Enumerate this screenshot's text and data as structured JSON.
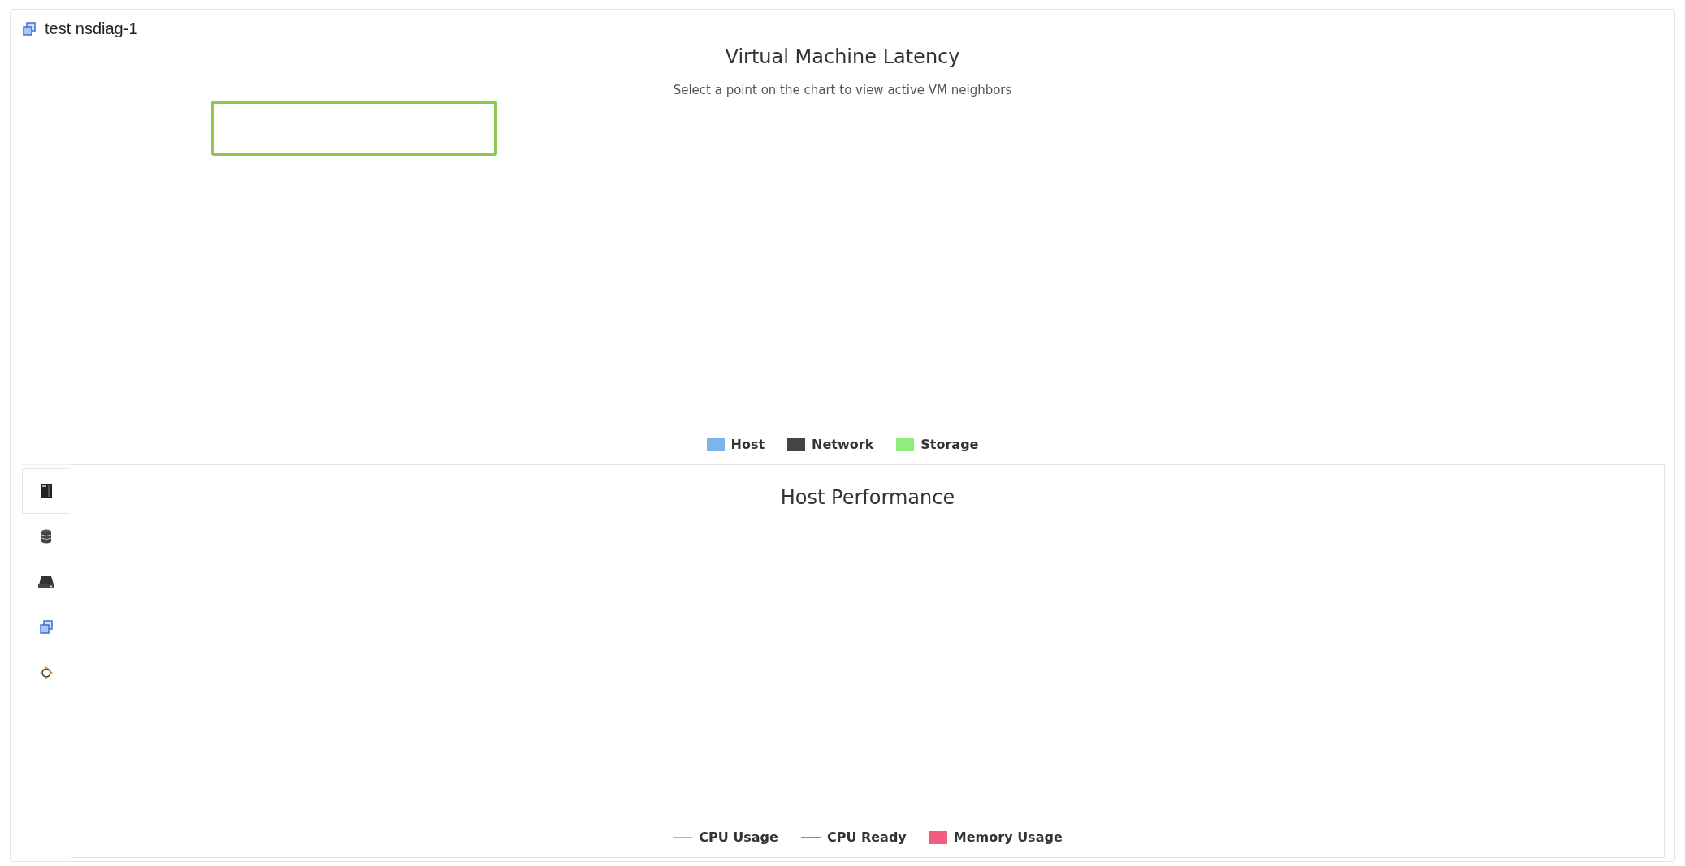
{
  "header": {
    "title": "test nsdiag-1"
  },
  "latency_chart": {
    "title": "Virtual Machine Latency",
    "subtitle": "Select a point on the chart to view active VM neighbors",
    "legend": [
      {
        "label": "Host",
        "kind": "swatch",
        "color": "#7cb5ec"
      },
      {
        "label": "Network",
        "kind": "swatch",
        "color": "#434348"
      },
      {
        "label": "Storage",
        "kind": "swatch",
        "color": "#90ed7d"
      }
    ]
  },
  "side_tabs": [
    {
      "kind": "server",
      "selected": true
    },
    {
      "kind": "database",
      "selected": false
    },
    {
      "kind": "drive",
      "selected": false
    },
    {
      "kind": "vm",
      "selected": false
    },
    {
      "kind": "network",
      "selected": false
    }
  ],
  "host_chart": {
    "title": "Host Performance",
    "legend": [
      {
        "label": "CPU Usage",
        "kind": "line",
        "color": "#f7a35c"
      },
      {
        "label": "CPU Ready",
        "kind": "line",
        "color": "#8085e9"
      },
      {
        "label": "Memory Usage",
        "kind": "swatch",
        "color": "#f15c80"
      }
    ]
  }
}
